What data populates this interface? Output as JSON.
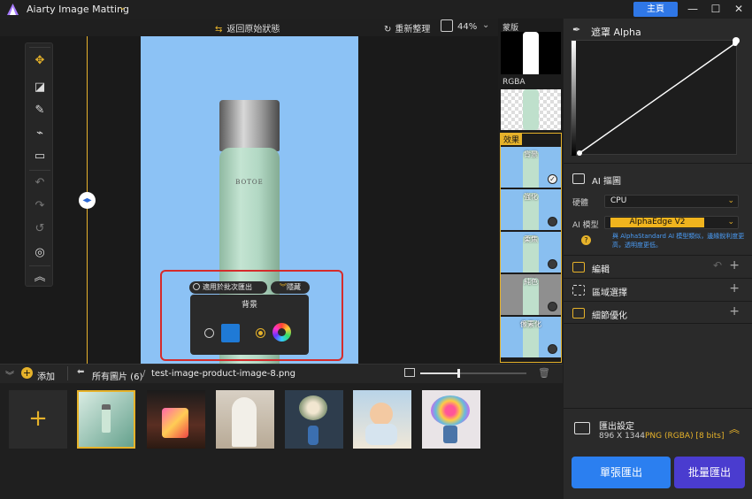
{
  "app": {
    "title": "Aiarty Image Matting",
    "home": "主頁"
  },
  "window": {
    "minimize": "—",
    "maximize": "☐",
    "close": "✕"
  },
  "toolbar": {
    "restore": "返回原始狀態",
    "reset": "重新整理",
    "zoom": "44%"
  },
  "tools": [
    "move-tool",
    "eraser-tool",
    "brush-tool",
    "broom-tool",
    "roller-tool",
    "undo",
    "redo",
    "reset",
    "focus",
    "collapse"
  ],
  "image": {
    "brand": "BOTOE"
  },
  "bg_popup": {
    "apply_label": "適用於批次匯出",
    "hide_label": "隱藏",
    "title": "背景"
  },
  "strip": {
    "mask_label": "蒙版",
    "rgba_label": "RGBA",
    "effect_label": "效果",
    "effects": [
      "背景",
      "強化",
      "柔焦",
      "純色",
      "像素化"
    ]
  },
  "right": {
    "alpha_title": "遮罩 Alpha",
    "ai_title": "AI 摳圖",
    "hardware_label": "硬體",
    "hardware_value": "CPU",
    "model_label": "AI 模型",
    "model_value": "AlphaEdge V2",
    "model_desc": "與 AlphaStandard AI 模型類似，邊緣銳利度更高，透明度更低。",
    "edit": "編輯",
    "region": "區域選擇",
    "refine": "細節優化"
  },
  "filmbar": {
    "add": "添加",
    "all_images": "所有圖片 (6)",
    "sep": "/",
    "filename": "test-image-product-image-8.png"
  },
  "export": {
    "title": "匯出設定",
    "size": "896 X 1344",
    "format": "PNG (RGBA) [8 bits]",
    "single": "單張匯出",
    "batch": "批量匯出"
  },
  "colors": {
    "accent": "#e6b22a",
    "primary": "#2b7ff0",
    "highlight": "#d52b2b"
  }
}
